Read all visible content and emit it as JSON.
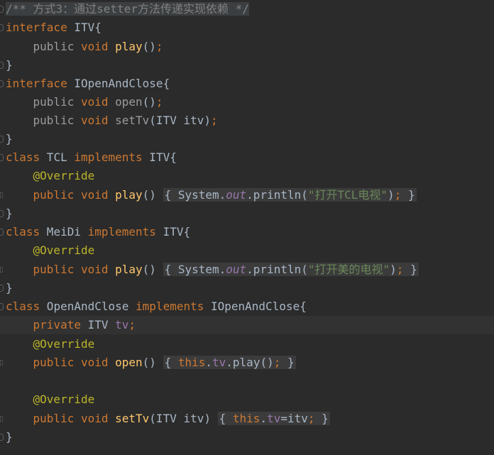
{
  "editor": {
    "lines": {
      "l01": {
        "comment": "/** 方式3：通过setter方法传递实现依赖 */"
      },
      "l02": {
        "kw": "interface",
        "name": " ITV",
        "brace": "{"
      },
      "l03": {
        "indent": "    ",
        "mod": "public",
        "kw": " void ",
        "fn": "play",
        "paren": "()",
        "semi": ";"
      },
      "l04": {
        "brace": "}"
      },
      "l05": {
        "kw": "interface",
        "name": " IOpenAndClose",
        "brace": "{"
      },
      "l06": {
        "indent": "    ",
        "mod": "public",
        "kw": " void ",
        "fn": "open",
        "paren": "()",
        "semi": ";"
      },
      "l07": {
        "indent": "    ",
        "mod": "public",
        "kw": " void ",
        "fn": "setTv",
        "params": "(ITV itv)",
        "semi": ";"
      },
      "l08": {
        "brace": "}"
      },
      "l09": {
        "kw": "class",
        "name": " TCL ",
        "kw2": "implements",
        "iface": " ITV",
        "brace": "{"
      },
      "l10": {
        "indent": "    ",
        "ann": "@Override"
      },
      "l11": {
        "indent": "    ",
        "kw": "public void ",
        "fn": "play",
        "paren": "() ",
        "open": "{",
        "body1": " System.",
        "static": "out",
        "body2": ".println(",
        "str": "\"打开TCL电视\"",
        "body3": ")",
        "semi": ";",
        "close": " }"
      },
      "l12": {
        "brace": "}"
      },
      "l13": {
        "kw": "class",
        "name": " MeiDi ",
        "kw2": "implements",
        "iface": " ITV",
        "brace": "{"
      },
      "l14": {
        "indent": "    ",
        "ann": "@Override"
      },
      "l15": {
        "indent": "    ",
        "kw": "public void ",
        "fn": "play",
        "paren": "() ",
        "open": "{",
        "body1": " System.",
        "static": "out",
        "body2": ".println(",
        "str": "\"打开美的电视\"",
        "body3": ")",
        "semi": ";",
        "close": " }"
      },
      "l16": {
        "brace": "}"
      },
      "l17": {
        "kw": "class",
        "name": " OpenAndClose ",
        "kw2": "implements",
        "iface": " IOpenAndClose",
        "brace": "{"
      },
      "l18": {
        "indent": "    ",
        "kw": "private",
        "type": " ITV ",
        "field": "tv",
        "semi": ";"
      },
      "l19": {
        "indent": "    ",
        "ann": "@Override"
      },
      "l20": {
        "indent": "    ",
        "kw": "public void ",
        "fn": "open",
        "paren": "() ",
        "open": "{",
        "this": " this",
        "dot": ".",
        "field": "tv",
        "call": ".play()",
        "semi": ";",
        "close": " }"
      },
      "l21": {},
      "l22": {
        "indent": "    ",
        "ann": "@Override"
      },
      "l23": {
        "indent": "    ",
        "kw": "public void ",
        "fn": "setTv",
        "params": "(ITV itv) ",
        "open": "{",
        "this": " this",
        "dot": ".",
        "field": "tv",
        "assign": "=itv",
        "semi": ";",
        "close": " }"
      },
      "l24": {
        "brace": "}"
      }
    }
  },
  "colors": {
    "background": "#2b2b2b",
    "keyword": "#cc7832",
    "function": "#ffc66d",
    "field": "#9876aa",
    "string": "#6a8759",
    "annotation": "#bbb529",
    "comment": "#808080",
    "text": "#a9b7c6"
  }
}
